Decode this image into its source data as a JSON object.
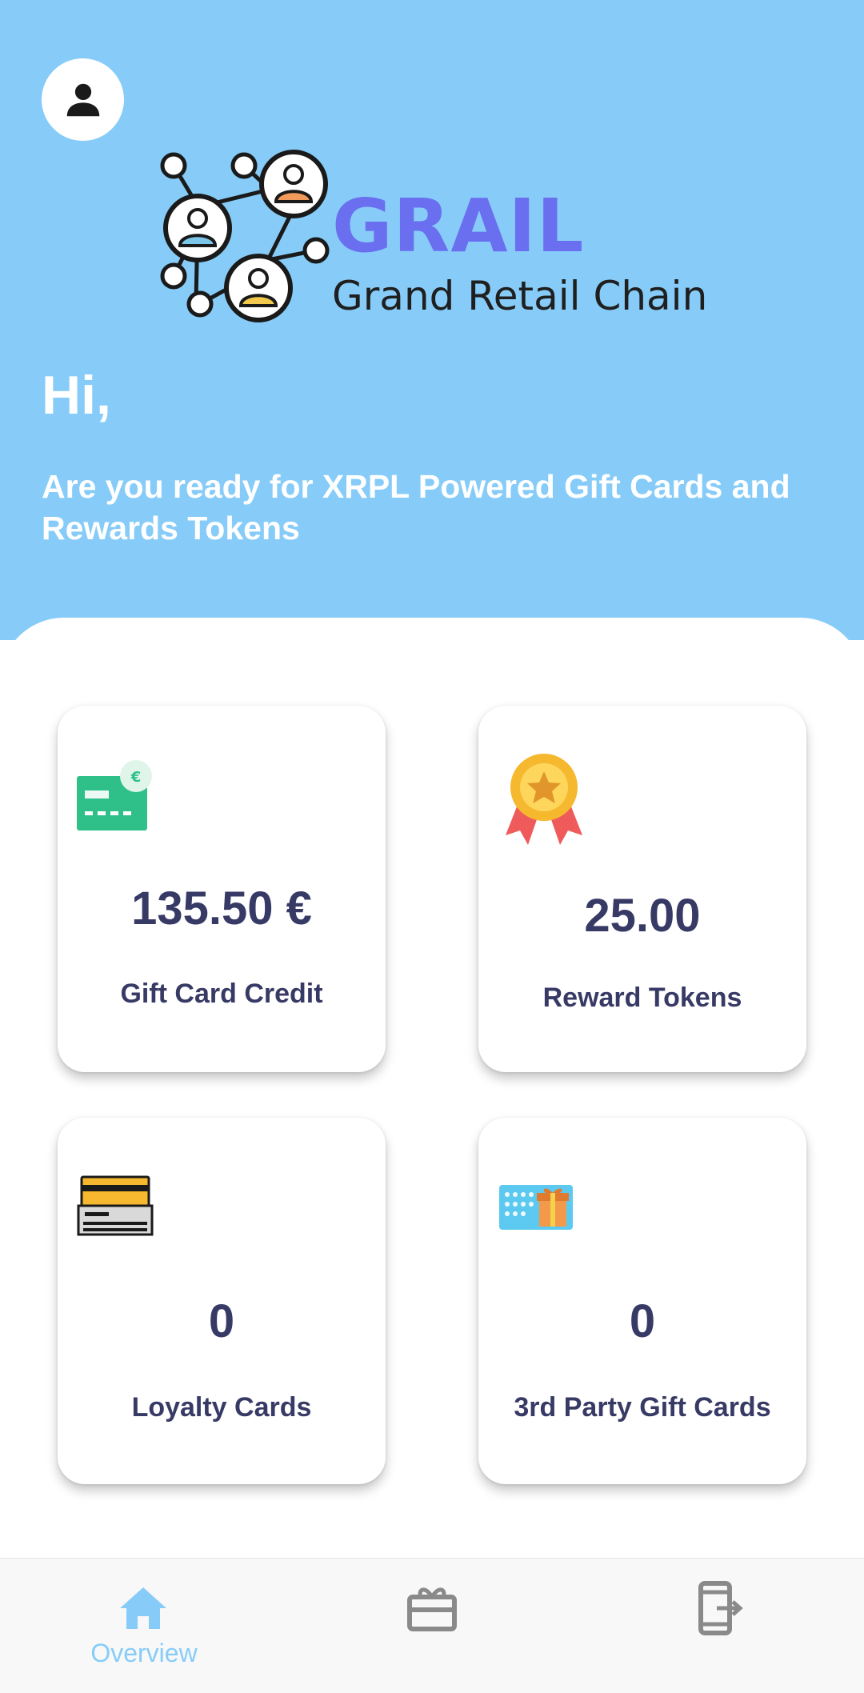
{
  "header": {
    "logo": {
      "brand": "GRAIL",
      "tagline": "Grand Retail Chain"
    },
    "greeting": "Hi,",
    "subtitle": "Are you ready for XRPL Powered Gift Cards and Rewards Tokens"
  },
  "cards": [
    {
      "value": "135.50 €",
      "label": "Gift Card Credit",
      "icon": "gift-card-euro-icon"
    },
    {
      "value": "25.00",
      "label": "Reward Tokens",
      "icon": "medal-icon"
    },
    {
      "value": "0",
      "label": "Loyalty Cards",
      "icon": "loyalty-card-icon"
    },
    {
      "value": "0",
      "label": "3rd Party Gift Cards",
      "icon": "gift-box-card-icon"
    }
  ],
  "nav": {
    "items": [
      {
        "label": "Overview",
        "icon": "home-icon",
        "active": true
      },
      {
        "label": "",
        "icon": "gift-cards-icon",
        "active": false
      },
      {
        "label": "",
        "icon": "logout-phone-icon",
        "active": false
      }
    ]
  },
  "colors": {
    "header_bg": "#87ccf8",
    "accent": "#87ccf8",
    "text_dark": "#383a66",
    "brand": "#6a6ff0"
  }
}
